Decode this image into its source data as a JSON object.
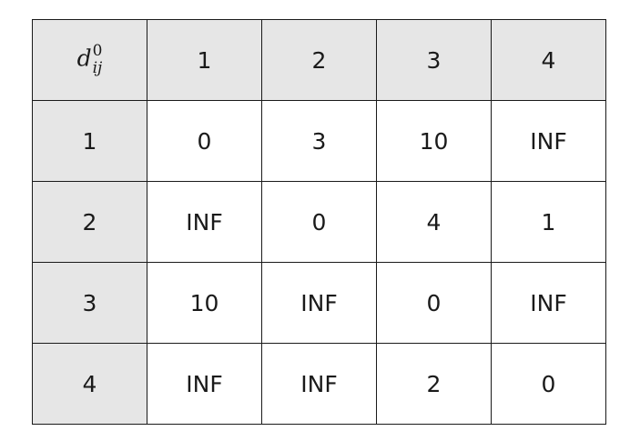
{
  "corner": {
    "symbol": "d",
    "superscript": "0",
    "subscript": "ij"
  },
  "column_headers": [
    "1",
    "2",
    "3",
    "4"
  ],
  "rows": [
    {
      "header": "1",
      "cells": [
        "0",
        "3",
        "10",
        "INF"
      ]
    },
    {
      "header": "2",
      "cells": [
        "INF",
        "0",
        "4",
        "1"
      ]
    },
    {
      "header": "3",
      "cells": [
        "10",
        "INF",
        "0",
        "INF"
      ]
    },
    {
      "header": "4",
      "cells": [
        "INF",
        "INF",
        "2",
        "0"
      ]
    }
  ],
  "colors": {
    "header_background": "#e6e6e6",
    "cell_background": "#ffffff",
    "border": "#1a1a1a"
  }
}
